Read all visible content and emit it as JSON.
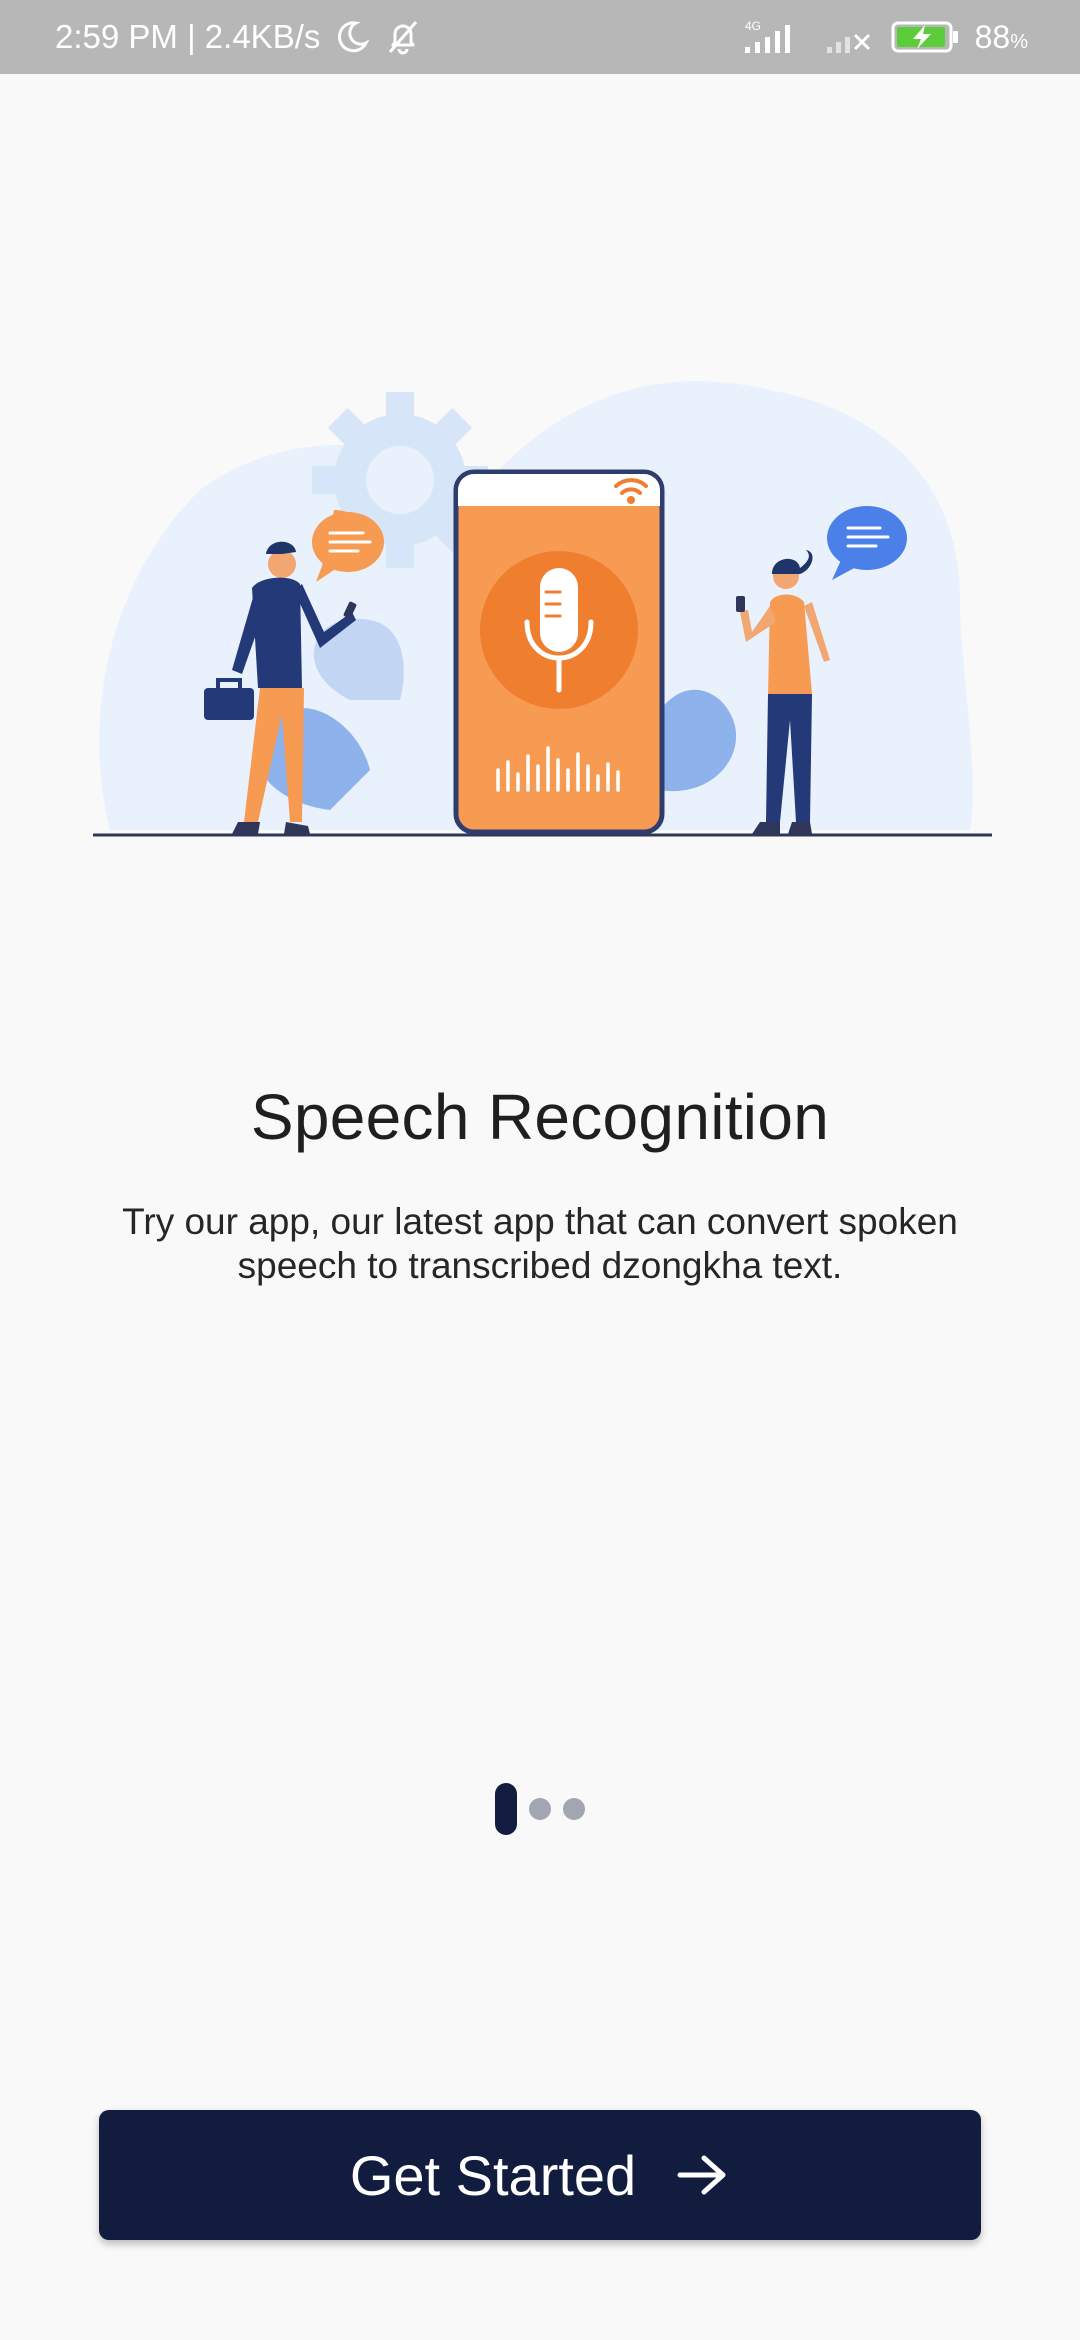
{
  "status_bar": {
    "time_speed": "2:59 PM | 2.4KB/s",
    "network_label": "4G",
    "battery_percent": "88",
    "battery_unit": "%",
    "icons": [
      "moon-icon",
      "bell-off-icon",
      "signal-4g-icon",
      "signal-no-service-icon",
      "battery-charging-icon"
    ]
  },
  "onboarding": {
    "title": "Speech Recognition",
    "description": "Try our app, our latest app that can convert spoken speech to transcribed dzongkha text.",
    "page_indicator": {
      "total": 3,
      "active_index": 0
    },
    "cta_label": "Get Started",
    "cta_icon": "arrow-right-icon"
  },
  "colors": {
    "status_bar_bg": "#b7b7b7",
    "page_bg": "#f9f9f9",
    "button_bg": "#111c3f",
    "accent_orange": "#f79a52",
    "accent_blue": "#4a80e8"
  }
}
